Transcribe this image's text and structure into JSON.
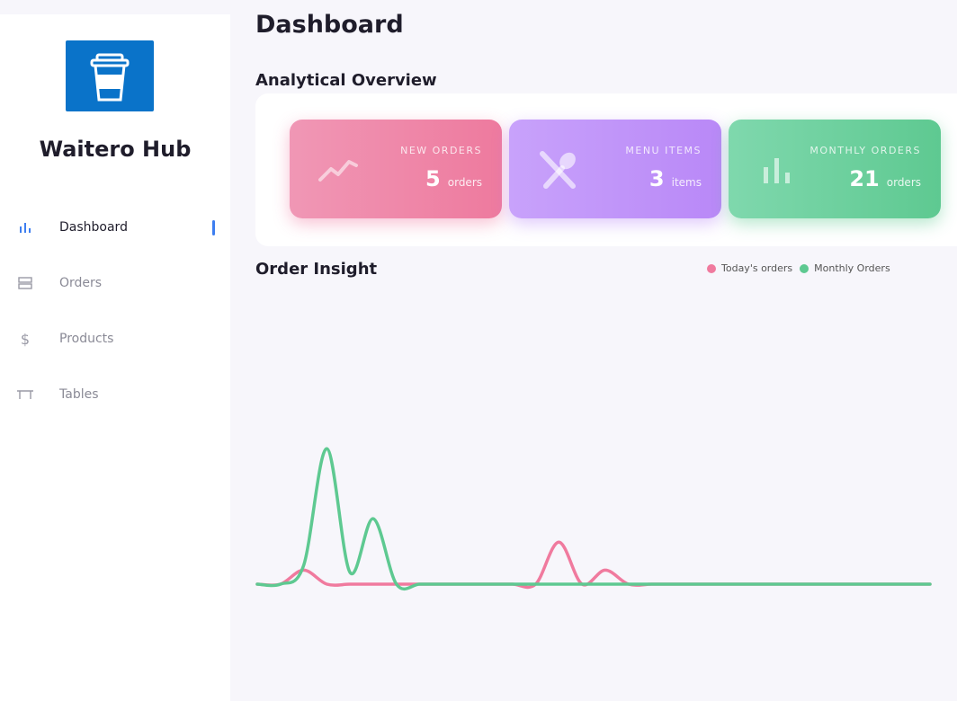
{
  "app": {
    "name": "Waitero Hub"
  },
  "sidebar": {
    "items": [
      {
        "label": "Dashboard",
        "icon": "bar-chart-icon",
        "active": true
      },
      {
        "label": "Orders",
        "icon": "rows-icon",
        "active": false
      },
      {
        "label": "Products",
        "icon": "dollar-icon",
        "active": false
      },
      {
        "label": "Tables",
        "icon": "table-icon",
        "active": false
      }
    ]
  },
  "main": {
    "title": "Dashboard",
    "overview_title": "Analytical Overview",
    "cards": [
      {
        "title": "NEW ORDERS",
        "value": "5",
        "unit": "orders",
        "icon": "trend-line-icon",
        "color": "#ee7a9e"
      },
      {
        "title": "MENU ITEMS",
        "value": "3",
        "unit": "items",
        "icon": "cutlery-icon",
        "color": "#b988f7"
      },
      {
        "title": "MONTHLY ORDERS",
        "value": "21",
        "unit": "orders",
        "icon": "bar-chart-icon",
        "color": "#5ec991"
      }
    ],
    "insight_title": "Order Insight"
  },
  "chart_data": {
    "type": "line",
    "x": [
      0,
      1,
      2,
      3,
      4,
      5,
      6,
      7,
      8,
      9,
      10,
      11,
      12,
      13,
      14,
      15,
      16,
      17,
      18,
      19,
      20,
      21,
      22,
      23,
      24,
      25,
      26,
      27,
      28,
      29
    ],
    "series": [
      {
        "name": "Today's orders",
        "color": "#f07a9e",
        "values": [
          0,
          0,
          0.6,
          0,
          0,
          0,
          0,
          0,
          0,
          0,
          0,
          0,
          0,
          1.8,
          0,
          0.6,
          0,
          0,
          0,
          0,
          0,
          0,
          0,
          0,
          0,
          0,
          0,
          0,
          0,
          0
        ]
      },
      {
        "name": "Monthly Orders",
        "color": "#5ec991",
        "values": [
          0,
          0,
          0.8,
          5.8,
          0.5,
          2.8,
          0,
          0,
          0,
          0,
          0,
          0,
          0,
          0,
          0,
          0,
          0,
          0,
          0,
          0,
          0,
          0,
          0,
          0,
          0,
          0,
          0,
          0,
          0,
          0
        ]
      }
    ],
    "grid": false,
    "legend": "top-right"
  }
}
